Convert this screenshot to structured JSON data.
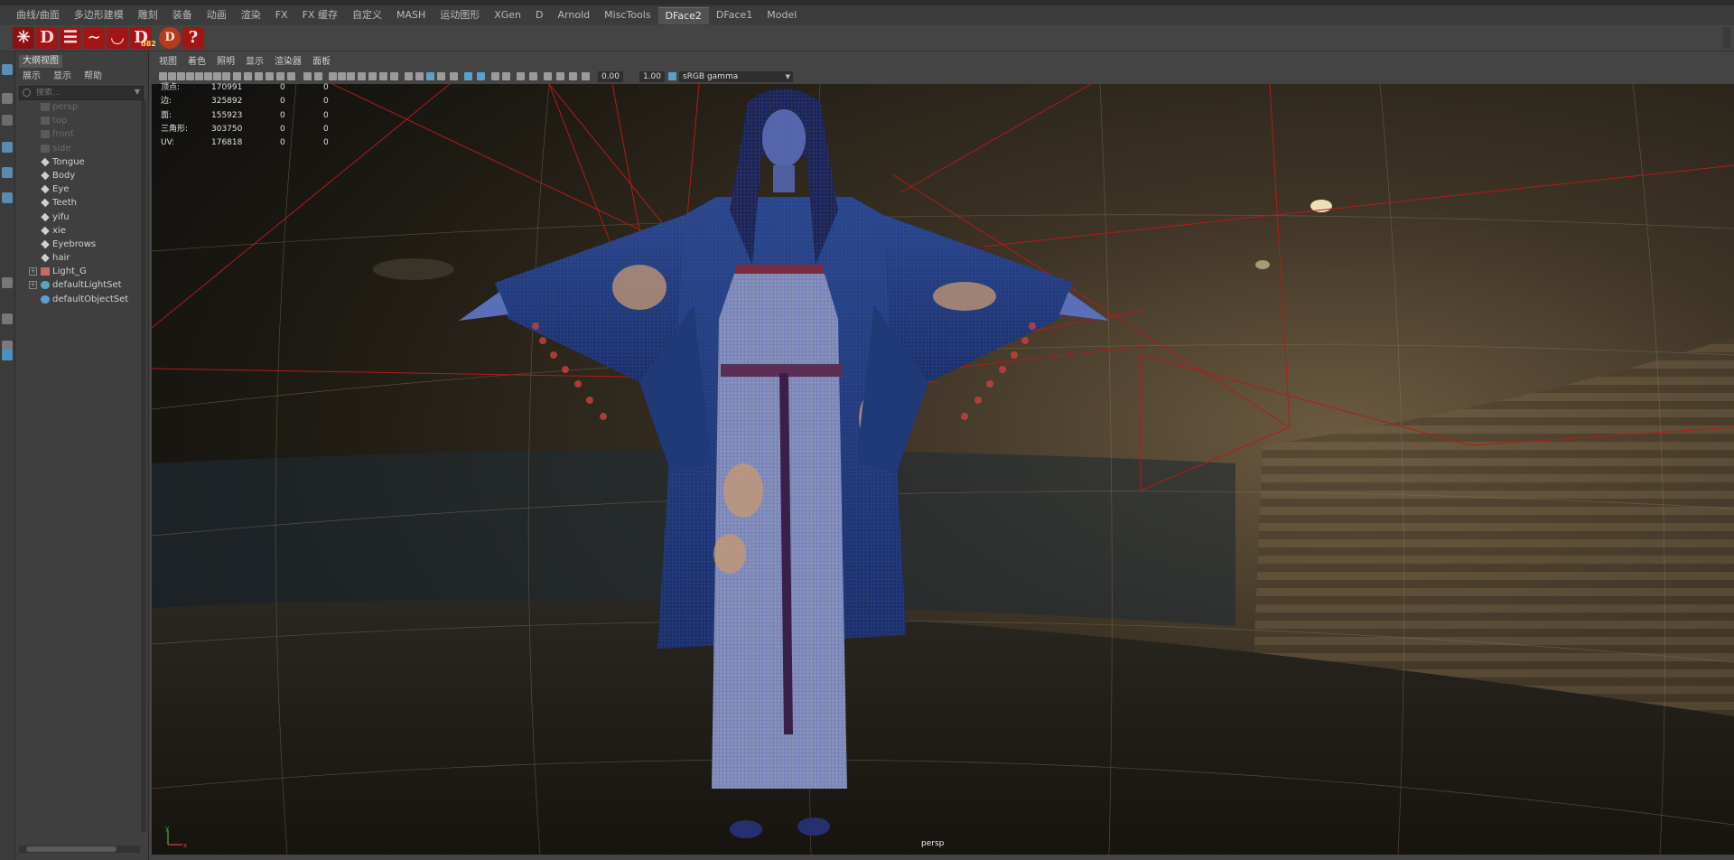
{
  "shelf_tabs": [
    {
      "label": "曲线/曲面",
      "active": false
    },
    {
      "label": "多边形建模",
      "active": false
    },
    {
      "label": "雕刻",
      "active": false
    },
    {
      "label": "装备",
      "active": false
    },
    {
      "label": "动画",
      "active": false
    },
    {
      "label": "渲染",
      "active": false
    },
    {
      "label": "FX",
      "active": false
    },
    {
      "label": "FX 缓存",
      "active": false
    },
    {
      "label": "自定义",
      "active": false
    },
    {
      "label": "MASH",
      "active": false
    },
    {
      "label": "运动图形",
      "active": false
    },
    {
      "label": "XGen",
      "active": false
    },
    {
      "label": "D",
      "active": false
    },
    {
      "label": "Arnold",
      "active": false
    },
    {
      "label": "MiscTools",
      "active": false
    },
    {
      "label": "DFace2",
      "active": true
    },
    {
      "label": "DFace1",
      "active": false
    },
    {
      "label": "Model",
      "active": false
    }
  ],
  "shelf_icons": [
    {
      "name": "figure-icon",
      "glyph": "🜲"
    },
    {
      "name": "dface-d-icon",
      "glyph": "D"
    },
    {
      "name": "lines-icon",
      "glyph": "☰"
    },
    {
      "name": "wave-icon",
      "glyph": "〜"
    },
    {
      "name": "bowl-icon",
      "glyph": "◡"
    },
    {
      "name": "d2-icon",
      "glyph": "D"
    },
    {
      "name": "d-badge-icon",
      "glyph": "D"
    },
    {
      "name": "help-icon",
      "glyph": "?"
    }
  ],
  "shelf_badge": "d82",
  "outliner": {
    "title": "大纲视图",
    "menu": [
      "展示",
      "显示",
      "帮助"
    ],
    "search_placeholder": "搜索...",
    "items": [
      {
        "label": "persp",
        "dim": true,
        "icon": "camera",
        "expand": false
      },
      {
        "label": "top",
        "dim": true,
        "icon": "camera",
        "expand": false
      },
      {
        "label": "front",
        "dim": true,
        "icon": "camera",
        "expand": false
      },
      {
        "label": "side",
        "dim": true,
        "icon": "camera",
        "expand": false
      },
      {
        "label": "Tongue",
        "dim": false,
        "icon": "mesh",
        "expand": false
      },
      {
        "label": "Body",
        "dim": false,
        "icon": "mesh",
        "expand": false
      },
      {
        "label": "Eye",
        "dim": false,
        "icon": "mesh",
        "expand": false
      },
      {
        "label": "Teeth",
        "dim": false,
        "icon": "mesh",
        "expand": false
      },
      {
        "label": "yifu",
        "dim": false,
        "icon": "mesh",
        "expand": false
      },
      {
        "label": "xie",
        "dim": false,
        "icon": "mesh",
        "expand": false
      },
      {
        "label": "Eyebrows",
        "dim": false,
        "icon": "mesh",
        "expand": false
      },
      {
        "label": "hair",
        "dim": false,
        "icon": "mesh",
        "expand": false
      },
      {
        "label": "Light_G",
        "dim": false,
        "icon": "group",
        "expand": true
      },
      {
        "label": "defaultLightSet",
        "dim": false,
        "icon": "set",
        "expand": true
      },
      {
        "label": "defaultObjectSet",
        "dim": false,
        "icon": "set",
        "expand": false
      }
    ]
  },
  "viewport": {
    "menu": [
      "视图",
      "着色",
      "照明",
      "显示",
      "渲染器",
      "面板"
    ],
    "exposure": "0.00",
    "gamma": "1.00",
    "color_space": "sRGB gamma",
    "camera": "persp",
    "hud": [
      {
        "label": "顶点:",
        "a": "170991",
        "b": "0",
        "c": "0"
      },
      {
        "label": "边:",
        "a": "325892",
        "b": "0",
        "c": "0"
      },
      {
        "label": "面:",
        "a": "155923",
        "b": "0",
        "c": "0"
      },
      {
        "label": "三角形:",
        "a": "303750",
        "b": "0",
        "c": "0"
      },
      {
        "label": "UV:",
        "a": "176818",
        "b": "0",
        "c": "0"
      }
    ]
  },
  "colors": {
    "active_tab": "#525252",
    "shelf_red": "#a31515",
    "wire_blue": "#2b3fa8",
    "robe_blue": "#243a73",
    "camera_lines": "#b51a1a"
  }
}
